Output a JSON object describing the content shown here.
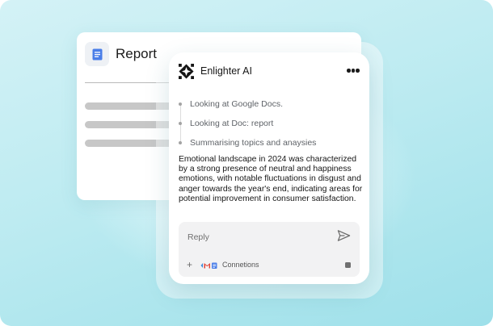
{
  "document": {
    "title": "Report",
    "icon": "doc-icon",
    "accent_color": "#4a7ee8"
  },
  "assistant": {
    "name": "Enlighter AI",
    "logo": "enlighter-logo-icon",
    "menu_icon": "more-options-icon",
    "steps": [
      "Looking at Google Docs.",
      "Looking at Doc: report",
      "Summarising topics and anaysies"
    ],
    "summary": "Emotional landscape in 2024 was characterized by a strong presence of neutral and happiness emotions, with notable fluctuations in disgust and anger towards the year's end, indicating areas for potential improvement in consumer satisfaction."
  },
  "composer": {
    "placeholder": "Reply",
    "connections_label": "Connetions",
    "icons": [
      "send-icon",
      "plus-icon",
      "gmail-icon",
      "docs-icon",
      "stop-icon"
    ]
  }
}
